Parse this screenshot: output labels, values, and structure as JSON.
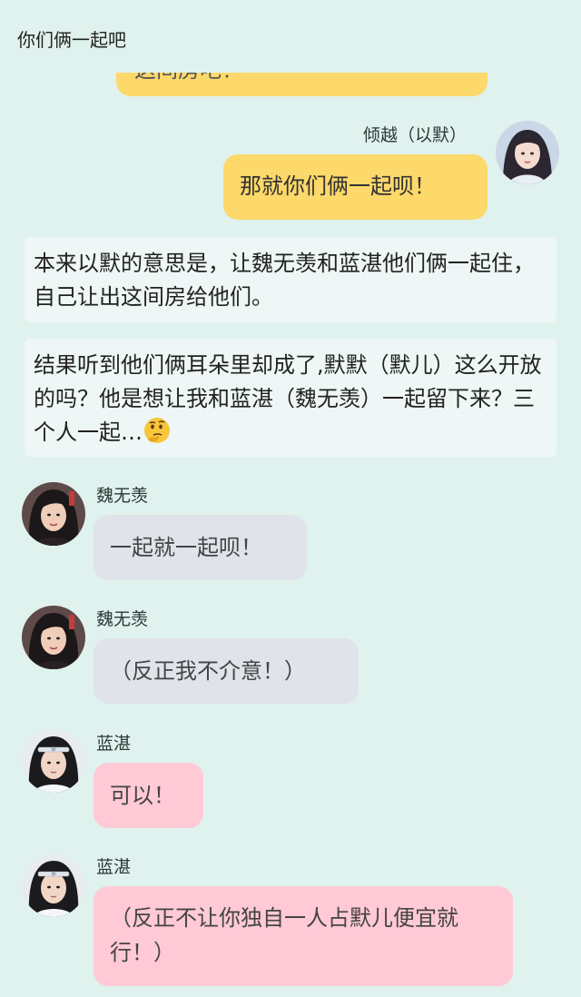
{
  "header": {
    "title": "你们俩一起吧"
  },
  "top_partial_bubble": {
    "text": "这间房吧！"
  },
  "messages": {
    "m1": {
      "sender": "倾越（以默）",
      "text": "那就你们俩一起呗！"
    },
    "n1": {
      "text": "本来以默的意思是，让魏无羡和蓝湛他们俩一起住，自己让出这间房给他们。"
    },
    "n2": {
      "text": "结果听到他们俩耳朵里却成了,默默（默儿）这么开放的吗？他是想让我和蓝湛（魏无羡）一起留下来？三个人一起…"
    },
    "m2": {
      "sender": "魏无羡",
      "text": "一起就一起呗！"
    },
    "m3": {
      "sender": "魏无羡",
      "text": "（反正我不介意！）"
    },
    "m4": {
      "sender": "蓝湛",
      "text": "可以！"
    },
    "m5": {
      "sender": "蓝湛",
      "text": "（反正不让你独自一人占默儿便宜就行！）"
    }
  },
  "icons": {
    "thinking": "thinking-face-emoji"
  }
}
